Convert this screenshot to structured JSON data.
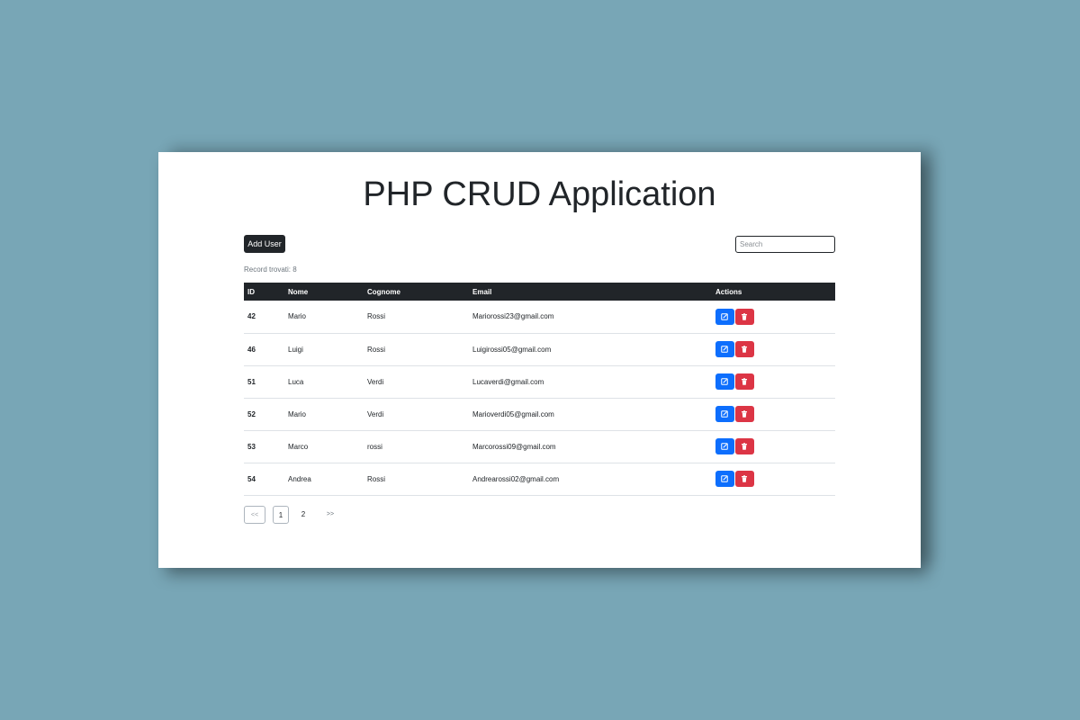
{
  "app": {
    "title": "PHP CRUD Application"
  },
  "toolbar": {
    "add_label": "Add User",
    "search_placeholder": "Search",
    "search_value": ""
  },
  "record_count": "Record trovati: 8",
  "table": {
    "headers": [
      "ID",
      "Nome",
      "Cognome",
      "Email",
      "Actions"
    ],
    "rows": [
      {
        "id": "42",
        "nome": "Mario",
        "cognome": "Rossi",
        "email": "Mariorossi23@gmail.com"
      },
      {
        "id": "46",
        "nome": "Luigi",
        "cognome": "Rossi",
        "email": "Luigirossi05@gmail.com"
      },
      {
        "id": "51",
        "nome": "Luca",
        "cognome": "Verdi",
        "email": "Lucaverdi@gmail.com"
      },
      {
        "id": "52",
        "nome": "Mario",
        "cognome": "Verdi",
        "email": "Marioverdi05@gmail.com"
      },
      {
        "id": "53",
        "nome": "Marco",
        "cognome": "rossi",
        "email": "Marcorossi09@gmail.com"
      },
      {
        "id": "54",
        "nome": "Andrea",
        "cognome": "Rossi",
        "email": "Andrearossi02@gmail.com"
      }
    ],
    "actions": {
      "edit_icon": "edit-icon",
      "delete_icon": "trash-icon"
    }
  },
  "pagination": {
    "prev": "<<",
    "pages": [
      "1",
      "2"
    ],
    "current": "1",
    "next": ">>"
  },
  "colors": {
    "background": "#78a6b6",
    "dark": "#212529",
    "primary": "#0d6efd",
    "danger": "#dc3545"
  }
}
